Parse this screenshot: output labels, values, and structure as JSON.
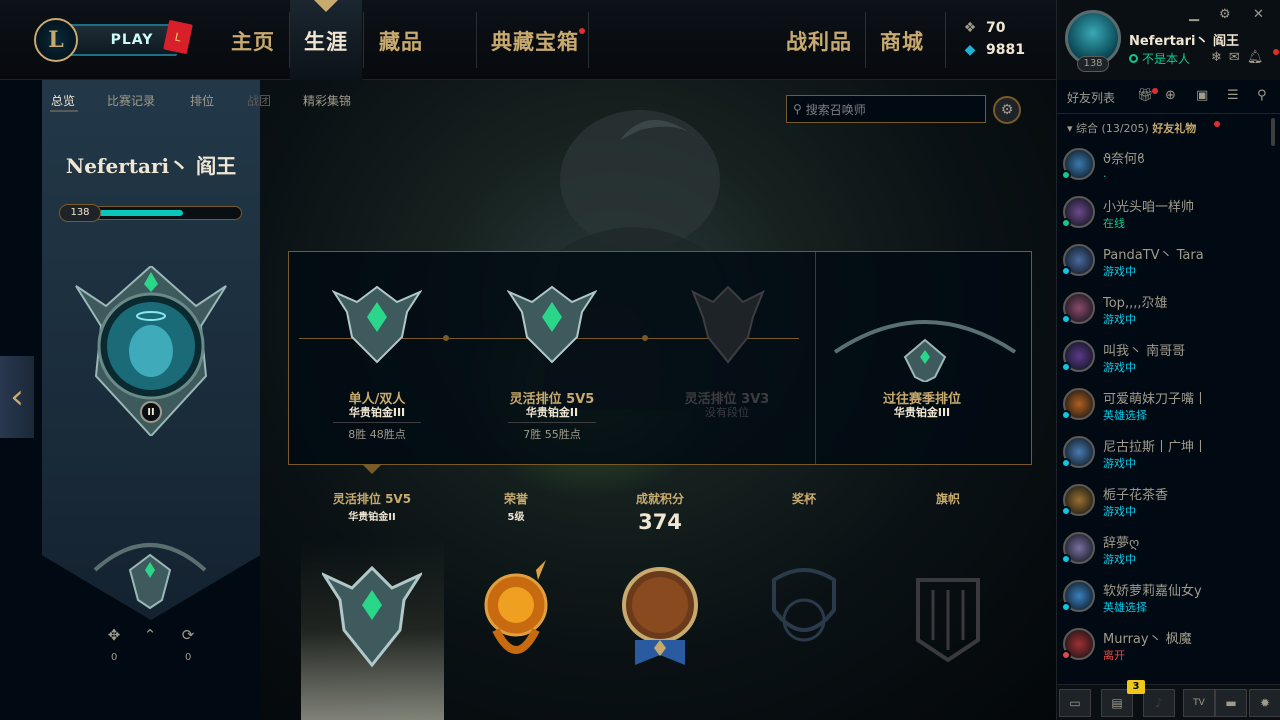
{
  "nav": {
    "play": "PLAY",
    "redpacket": "L",
    "logo": "L",
    "items": [
      "主页",
      "生涯",
      "藏品",
      "典藏宝箱",
      "战利品",
      "商城"
    ],
    "active": "生涯"
  },
  "currency": {
    "be_icon": "blue-essence-icon",
    "be": "70",
    "rp_icon": "riot-points-icon",
    "rp": "9881"
  },
  "profile": {
    "name": "Nefertari丶 阎王",
    "status": "不是本人",
    "level": "138"
  },
  "subnav": {
    "items": [
      "总览",
      "比赛记录",
      "排位",
      "战团",
      "精彩集锦"
    ],
    "active": "总览"
  },
  "search": {
    "placeholder": "搜索召唤师"
  },
  "banner": {
    "name": "Nefertari丶 阎王",
    "level": "138",
    "xp_fraction": 0.6,
    "pause": "II",
    "stats": [
      "0",
      "0"
    ]
  },
  "ranked": {
    "queues": [
      {
        "title": "单人/双人",
        "tier": "华贵铂金III",
        "stat": "8胜 48胜点",
        "dim": false
      },
      {
        "title": "灵活排位 5V5",
        "tier": "华贵铂金II",
        "stat": "7胜 55胜点",
        "dim": false
      },
      {
        "title": "灵活排位 3V3",
        "tier": "没有段位",
        "stat": "",
        "dim": true
      }
    ],
    "past": {
      "title": "过往赛季排位",
      "tier": "华贵铂金III"
    }
  },
  "bottom": {
    "items": [
      {
        "title": "灵活排位 5V5",
        "sub": "华贵铂金II"
      },
      {
        "title": "荣誉",
        "sub": "5级"
      },
      {
        "title": "成就积分",
        "score": "374"
      },
      {
        "title": "奖杯"
      },
      {
        "title": "旗帜"
      }
    ]
  },
  "friends": {
    "title": "好友列表",
    "group": "综合 (13/205)",
    "gift_label": "好友礼物",
    "list": [
      {
        "name": "ϑ奈何ϐ",
        "status": ".",
        "color": "#0acb8a",
        "av": "#3a7ab0"
      },
      {
        "name": "小光头咱一样帅",
        "status": "在线",
        "color": "#0acb8a",
        "av": "#6a4a8a"
      },
      {
        "name": "PandaTV丶 Tara",
        "status": "游戏中",
        "color": "#0ac8e6",
        "av": "#4a6aa0"
      },
      {
        "name": "Top,,,,尕雄",
        "status": "游戏中",
        "color": "#0ac8e6",
        "av": "#8a4a6a"
      },
      {
        "name": "叫我丶 南哥哥",
        "status": "游戏中",
        "color": "#0ac8e6",
        "av": "#5a3a8a"
      },
      {
        "name": "可爱萌妹刀子嘴丨",
        "status": "英雄选择",
        "color": "#0ac8e6",
        "av": "#b06020"
      },
      {
        "name": "尼古拉斯丨广坤丨",
        "status": "游戏中",
        "color": "#0ac8e6",
        "av": "#4a7ab0"
      },
      {
        "name": "栀子花茶香",
        "status": "游戏中",
        "color": "#0ac8e6",
        "av": "#9a7030"
      },
      {
        "name": "辞夢ღ",
        "status": "游戏中",
        "color": "#0ac8e6",
        "av": "#7a70a0"
      },
      {
        "name": "软娇萝莉嘉仙女y",
        "status": "英雄选择",
        "color": "#0ac8e6",
        "av": "#3a80c0"
      },
      {
        "name": "Murray丶 枫魔",
        "status": "离开",
        "color": "#e04848",
        "av": "#a03030"
      }
    ],
    "badge": "3"
  }
}
